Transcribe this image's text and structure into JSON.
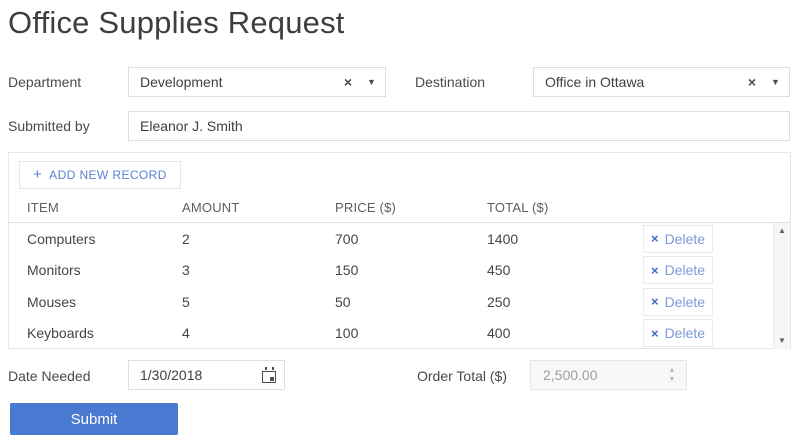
{
  "page": {
    "title": "Office Supplies Request"
  },
  "colors": {
    "accent_blue": "#4a79d1",
    "link_blue": "#5b82d3",
    "dirty_red": "#ae3a28",
    "border_gray": "#dedede",
    "disabled_bg": "#f8f8f8"
  },
  "icons": {
    "clear": "×",
    "dropdown": "▼",
    "plus": "+",
    "delete_x": "×",
    "spin_up": "▲",
    "spin_down": "▼",
    "scroll_up": "▲",
    "scroll_down": "▼"
  },
  "form": {
    "department": {
      "label": "Department",
      "value": "Development"
    },
    "destination": {
      "label": "Destination",
      "value": "Office in Ottawa"
    },
    "submitted_by": {
      "label": "Submitted by",
      "value": "Eleanor J. Smith"
    },
    "date_needed": {
      "label": "Date Needed",
      "value": "1/30/2018"
    },
    "order_total": {
      "label": "Order Total ($)",
      "value": "2,500.00"
    },
    "submit_label": "Submit"
  },
  "grid": {
    "toolbar": {
      "add_label": "ADD NEW RECORD"
    },
    "columns": [
      "ITEM",
      "AMOUNT",
      "PRICE ($)",
      "TOTAL ($)"
    ],
    "delete_label": "Delete",
    "rows": [
      {
        "item": "Computers",
        "amount": "2",
        "price": "700",
        "total": "1400"
      },
      {
        "item": "Monitors",
        "amount": "3",
        "price": "150",
        "total": "450"
      },
      {
        "item": "Mouses",
        "amount": "5",
        "price": "50",
        "total": "250"
      },
      {
        "item": "Keyboards",
        "amount": "4",
        "price": "100",
        "total": "400"
      }
    ]
  }
}
